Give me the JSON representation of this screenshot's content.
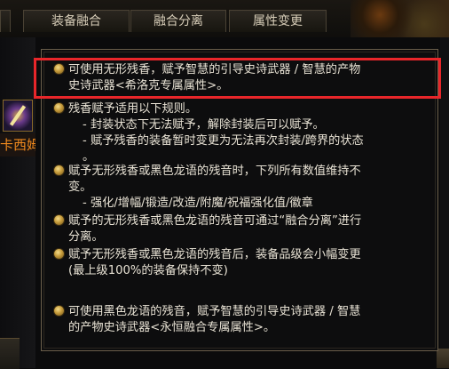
{
  "tabs": [
    {
      "label": "装备融合"
    },
    {
      "label": "融合分离"
    },
    {
      "label": "属性变更"
    }
  ],
  "left_panel": {
    "item_name": "卡西姆rt"
  },
  "tooltip": {
    "entries": [
      {
        "lines": [
          "可使用无形残香，赋予智慧的引导史诗武器 / 智慧的产物",
          "史诗武器<希洛克专属属性>。"
        ]
      },
      {
        "lines": [
          "残香赋予适用以下规则。"
        ],
        "subs": [
          "- 封装状态下无法赋予，解除封装后可以赋予。",
          "- 赋予残香的装备暂时变更为无法再次封装/跨界的状态",
          "。"
        ]
      },
      {
        "lines": [
          "赋予无形残香或黑色龙语的残音时，下列所有数值维持不",
          "变。"
        ],
        "subs": [
          "- 强化/增幅/锻造/改造/附魔/祝福强化值/徽章"
        ]
      },
      {
        "lines": [
          "赋予的无形残香或黑色龙语的残音可通过“融合分离”进行",
          "分离。"
        ]
      },
      {
        "lines": [
          "赋予无形残香或黑色龙语的残音后，装备品级会小幅变更",
          "(最上级100%的装备保持不变)"
        ]
      },
      {
        "lines": [
          "可使用黑色龙语的残音，赋予智慧的引导史诗武器 / 智慧",
          "的产物史诗武器<永恒融合专属属性>。"
        ]
      }
    ]
  },
  "colors": {
    "highlight_border": "#e8262a",
    "tooltip_text": "#e8e2d4",
    "tab_text": "#d7cdb8",
    "item_name": "#f08a1e"
  }
}
